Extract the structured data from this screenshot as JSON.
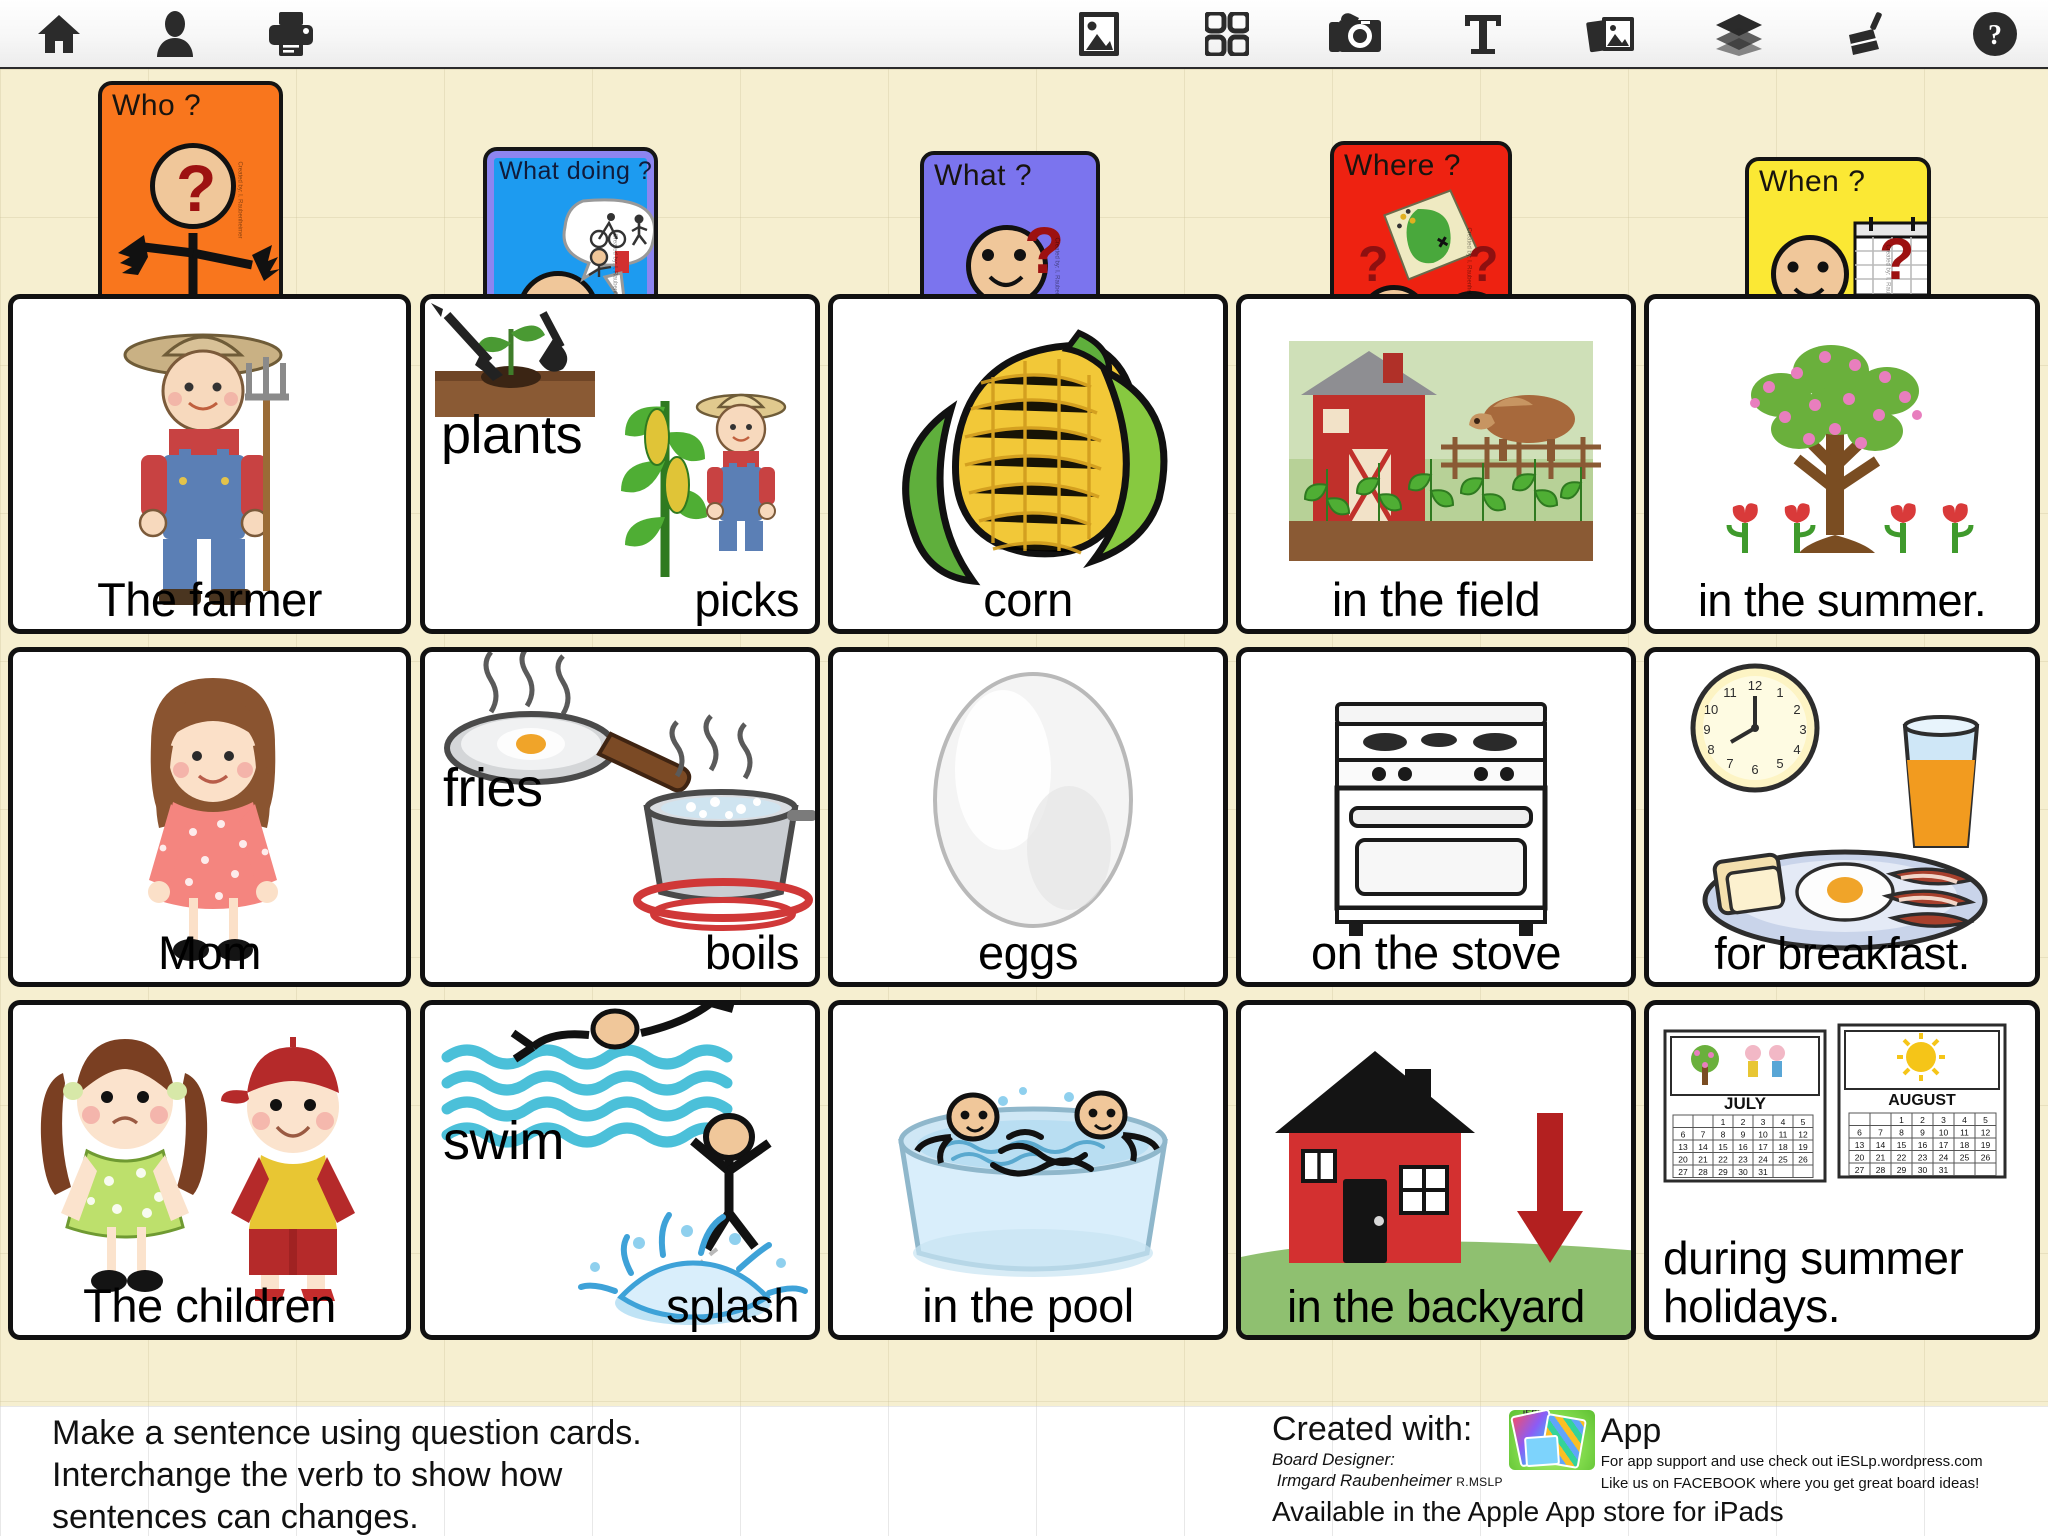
{
  "toolbar": {
    "left_items": [
      {
        "name": "home-icon",
        "label": "Home"
      },
      {
        "name": "user-icon",
        "label": "User"
      },
      {
        "name": "print-icon",
        "label": "Print"
      }
    ],
    "right_items": [
      {
        "name": "image-icon",
        "label": "Image"
      },
      {
        "name": "grid-icon",
        "label": "Grid"
      },
      {
        "name": "camera-icon",
        "label": "Camera"
      },
      {
        "name": "text-icon",
        "label": "Text"
      },
      {
        "name": "stack-photos-icon",
        "label": "Photos"
      },
      {
        "name": "layers-icon",
        "label": "Layers"
      },
      {
        "name": "broom-icon",
        "label": "Clear"
      },
      {
        "name": "help-icon",
        "label": "Help"
      }
    ]
  },
  "question_cards": [
    {
      "label": "Who ?",
      "color": "#F9761D",
      "text_color": "#18140f",
      "credit": "Created by: I. Raubenheimer R.",
      "side": "Created by: I. Raubenheimer"
    },
    {
      "label": "What doing ?",
      "color": "#1D9BF0",
      "text_color": "#101b3a",
      "credit": "Created by: I. Raubenheimer  R.MSLP",
      "side": "Created by: I. Raubenheimer"
    },
    {
      "label": "What ?",
      "color": "#7B74EE",
      "text_color": "#0c0c18",
      "credit": "Created by: I. Raubenheimer  R.MSLP",
      "side": "Created by: I. Raubenheimer"
    },
    {
      "label": "Where ?",
      "color": "#EE2211",
      "text_color": "#1a0000",
      "credit": "Created by: I. Raubenheimer  R.MSLP",
      "side": "Created by: I. Raubenheimer"
    },
    {
      "label": "When ?",
      "color": "#FBE834",
      "text_color": "#141005",
      "credit": "Created by: I. Raubenheimer  R.MSLP",
      "side": "Created by: I. Raubenheimer"
    }
  ],
  "sentence_rows": [
    {
      "name": "farmer-sentence",
      "cells": [
        {
          "name": "subject",
          "text": "The farmer",
          "art": "farmer"
        },
        {
          "name": "verb",
          "text": "picks",
          "art": "plants-picks",
          "extra_text": "plants"
        },
        {
          "name": "object",
          "text": "corn",
          "art": "corn"
        },
        {
          "name": "place",
          "text": "in the field",
          "art": "field"
        },
        {
          "name": "time",
          "text": "in the summer.",
          "art": "blossom-tree"
        }
      ]
    },
    {
      "name": "mom-sentence",
      "cells": [
        {
          "name": "subject",
          "text": "Mom",
          "art": "mom"
        },
        {
          "name": "verb",
          "text": "boils",
          "art": "fries-boils",
          "extra_text": "fries"
        },
        {
          "name": "object",
          "text": "eggs",
          "art": "egg"
        },
        {
          "name": "place",
          "text": "on the stove",
          "art": "stove"
        },
        {
          "name": "time",
          "text": "for breakfast.",
          "art": "breakfast"
        }
      ]
    },
    {
      "name": "children-sentence",
      "cells": [
        {
          "name": "subject",
          "text": "The children",
          "art": "children"
        },
        {
          "name": "verb",
          "text": "splash",
          "art": "swim-splash",
          "extra_text": "swim"
        },
        {
          "name": "object",
          "text": "in the pool",
          "art": "pool"
        },
        {
          "name": "place",
          "text": "in the backyard",
          "art": "house-backyard"
        },
        {
          "name": "time",
          "text": "during summer holidays.",
          "art": "calendar-july-august"
        }
      ]
    }
  ],
  "footer": {
    "instructions": "Make a sentence using question cards. Interchange the verb to show how sentences can changes.",
    "created_with": "Created with:",
    "app_word": "App",
    "board_designer_label": "Board Designer:",
    "designer_name": "Irmgard Raubenheimer",
    "designer_credential": "R.MSLP",
    "available": "Available in the Apple App store for iPads",
    "support_line": "For app support and use check out  iESLp.wordpress.com",
    "facebook_line": "Like us on FACEBOOK where you get great board ideas!",
    "app_badge": "iESLp"
  },
  "calendar": {
    "july_label": "JULY",
    "august_label": "AUGUST",
    "rows": [
      [
        "",
        "",
        "1",
        "2",
        "3",
        "4",
        "5"
      ],
      [
        "6",
        "7",
        "8",
        "9",
        "10",
        "11",
        "12"
      ],
      [
        "13",
        "14",
        "15",
        "16",
        "17",
        "18",
        "19"
      ],
      [
        "20",
        "21",
        "22",
        "23",
        "24",
        "25",
        "26"
      ],
      [
        "27",
        "28",
        "29",
        "30",
        "31",
        "",
        ""
      ]
    ]
  },
  "colors": {
    "board_background": "#F6EFD0",
    "card_background": "#FFFFFF",
    "card_border": "#111111",
    "toolbar_background": "#FFFFFF"
  }
}
